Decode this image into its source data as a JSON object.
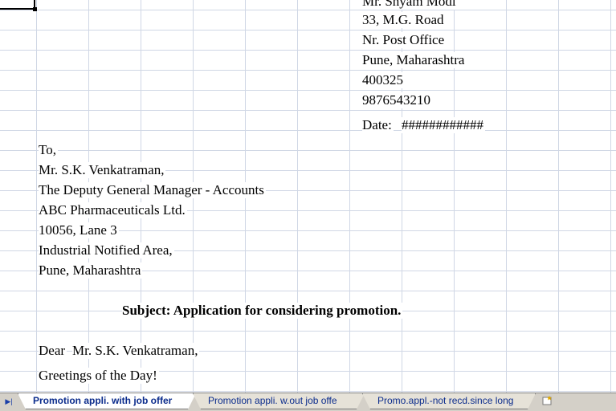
{
  "sender": {
    "name": "Mr. Shyam Modi",
    "address_line1": "33, M.G. Road",
    "address_line2": "Nr. Post Office",
    "city_state": "Pune, Maharashtra",
    "pin": "400325",
    "phone": "9876543210",
    "date_label": "Date:",
    "date_value": "############"
  },
  "recipient": {
    "to": "To,",
    "name": "Mr. S.K. Venkatraman,",
    "designation": "The Deputy General Manager - Accounts",
    "company": "ABC Pharmaceuticals Ltd.",
    "address_line1": "10056, Lane 3",
    "address_line2": "Industrial Notified Area,",
    "city_state": "Pune, Maharashtra"
  },
  "subject": "Subject: Application for considering promotion.",
  "salutation": {
    "dear": "Dear",
    "name": "Mr. S.K. Venkatraman,"
  },
  "greeting": "Greetings of the Day!",
  "sheet_tabs": [
    {
      "label": "Promotion appli. with job offer",
      "active": true
    },
    {
      "label": "Promotion appli. w.out job offe",
      "active": false
    },
    {
      "label": "Promo.appl.-not recd.since long",
      "active": false
    }
  ],
  "nav_buttons": {
    "last": "▶|"
  },
  "colors": {
    "gridline": "#d0d7e5",
    "tab_text": "#0b2c8c",
    "tabbar_bg": "#d4d0c8"
  }
}
